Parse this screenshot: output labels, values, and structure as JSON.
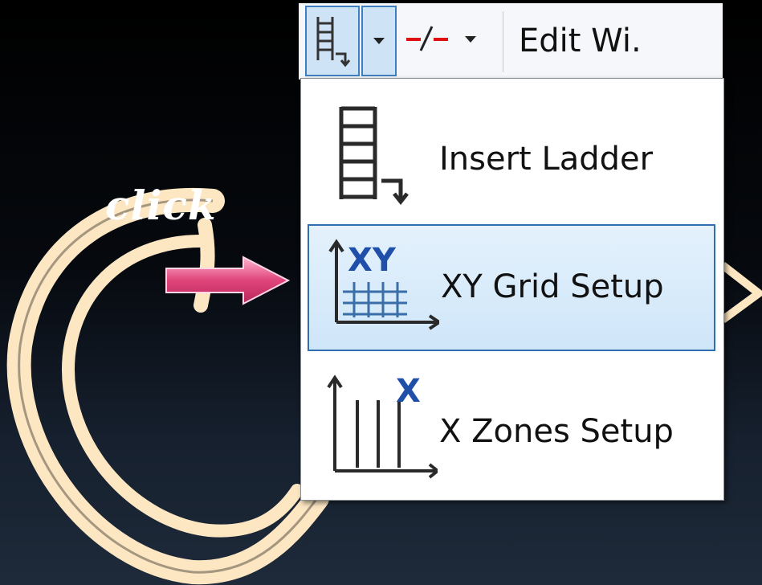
{
  "toolbar": {
    "insert_ladder_icon": "ladder-icon",
    "dropdown_icon": "chevron-down-icon",
    "wire_icon": "wire-break-icon",
    "edit_label": "Edit Wi."
  },
  "menu": {
    "items": [
      {
        "label": "Insert Ladder",
        "icon": "ladder-icon"
      },
      {
        "label": "XY Grid Setup",
        "icon": "xy-grid-icon"
      },
      {
        "label": "X Zones Setup",
        "icon": "x-zones-icon"
      }
    ],
    "selected": "XY Grid Setup"
  },
  "annotation": {
    "label": "click",
    "arrow_color": "#e0457a",
    "swirl_color": "#fde7c3"
  }
}
